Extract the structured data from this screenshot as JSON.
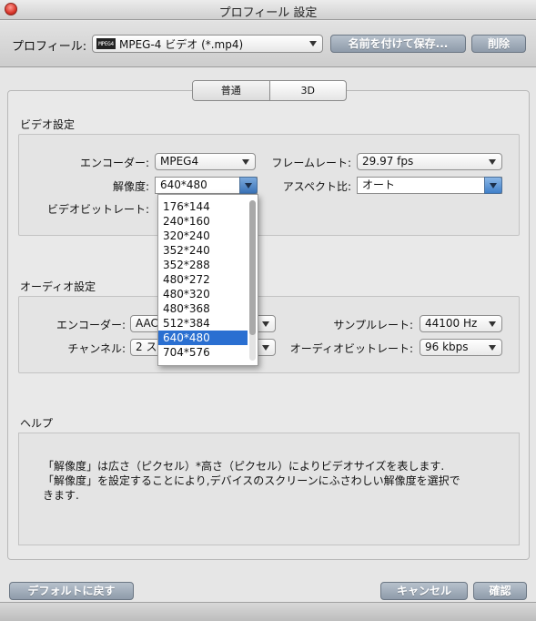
{
  "window": {
    "title": "プロフィール 設定"
  },
  "toolbar": {
    "profile_label": "プロフィール:",
    "profile_value": "MPEG-4 ビデオ (*.mp4)",
    "profile_icon_text": "MPEG4",
    "save_as_label": "名前を付けて保存...",
    "delete_label": "削除"
  },
  "tabs": [
    {
      "label": "普通"
    },
    {
      "label": "3D"
    }
  ],
  "video": {
    "section_title": "ビデオ設定",
    "encoder_label": "エンコーダー:",
    "encoder_value": "MPEG4",
    "framerate_label": "フレームレート:",
    "framerate_value": "29.97 fps",
    "resolution_label": "解像度:",
    "resolution_value": "640*480",
    "aspect_label": "アスペクト比:",
    "aspect_value": "オート",
    "bitrate_label": "ビデオビットレート:"
  },
  "resolution_options": [
    "176*144",
    "240*160",
    "320*240",
    "352*240",
    "352*288",
    "480*272",
    "480*320",
    "480*368",
    "512*384",
    "640*480",
    "704*576"
  ],
  "resolution_selected_index": 9,
  "audio": {
    "section_title": "オーディオ設定",
    "encoder_label": "エンコーダー:",
    "encoder_value": "AAC",
    "channel_label": "チャンネル:",
    "channel_value": "2 ス",
    "samplerate_label": "サンプルレート:",
    "samplerate_value": "44100 Hz",
    "bitrate_label": "オーディオビットレート:",
    "bitrate_value": "96 kbps"
  },
  "help": {
    "section_title": "ヘルプ",
    "lines": [
      "「解像度」は広さ（ピクセル）*高さ（ピクセル）によりビデオサイズを表します.",
      "「解像度」を設定することにより,デバイスのスクリーンにふさわしい解像度を選択で",
      "きます."
    ]
  },
  "footer": {
    "reset_label": "デフォルトに戻す",
    "cancel_label": "キャンセル",
    "ok_label": "確認"
  }
}
